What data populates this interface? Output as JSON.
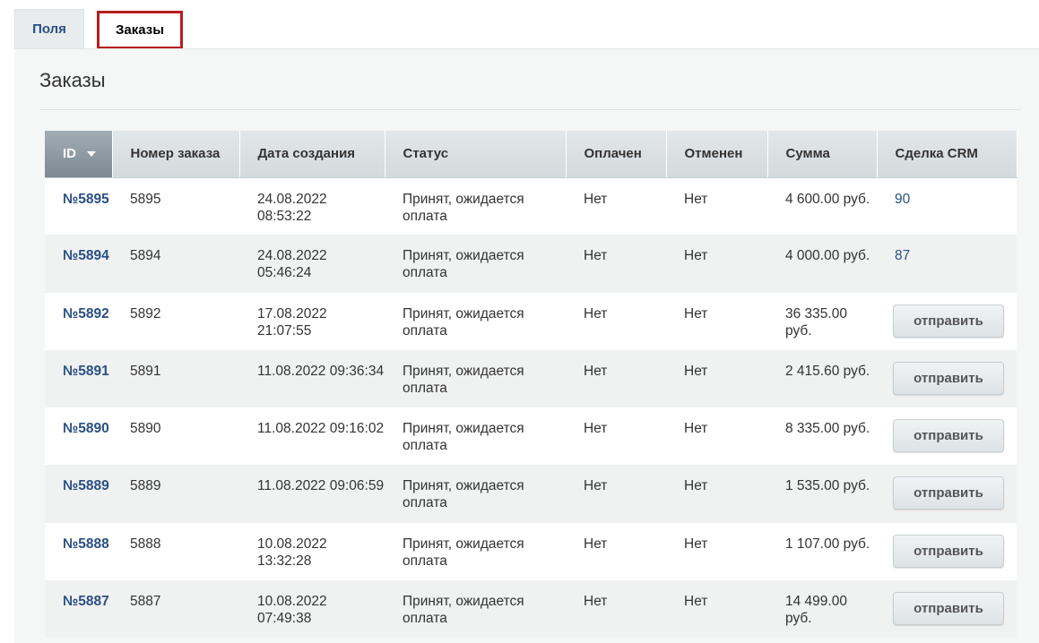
{
  "tabs": [
    {
      "label": "Поля"
    },
    {
      "label": "Заказы"
    }
  ],
  "section_title": "Заказы",
  "columns": [
    "ID",
    "Номер заказа",
    "Дата создания",
    "Статус",
    "Оплачен",
    "Отменен",
    "Сумма",
    "Сделка CRM"
  ],
  "rows": [
    {
      "id": "№5895",
      "number": "5895",
      "date": "24.08.2022 08:53:22",
      "status": "Принят, ожидается оплата",
      "paid": "Нет",
      "canceled": "Нет",
      "sum": "4 600.00 руб.",
      "deal": "90",
      "action": ""
    },
    {
      "id": "№5894",
      "number": "5894",
      "date": "24.08.2022 05:46:24",
      "status": "Принят, ожидается оплата",
      "paid": "Нет",
      "canceled": "Нет",
      "sum": "4 000.00 руб.",
      "deal": "87",
      "action": ""
    },
    {
      "id": "№5892",
      "number": "5892",
      "date": "17.08.2022 21:07:55",
      "status": "Принят, ожидается оплата",
      "paid": "Нет",
      "canceled": "Нет",
      "sum": "36 335.00 руб.",
      "deal": "",
      "action": "отправить"
    },
    {
      "id": "№5891",
      "number": "5891",
      "date": "11.08.2022 09:36:34",
      "status": "Принят, ожидается оплата",
      "paid": "Нет",
      "canceled": "Нет",
      "sum": "2 415.60 руб.",
      "deal": "",
      "action": "отправить"
    },
    {
      "id": "№5890",
      "number": "5890",
      "date": "11.08.2022 09:16:02",
      "status": "Принят, ожидается оплата",
      "paid": "Нет",
      "canceled": "Нет",
      "sum": "8 335.00 руб.",
      "deal": "",
      "action": "отправить"
    },
    {
      "id": "№5889",
      "number": "5889",
      "date": "11.08.2022 09:06:59",
      "status": "Принят, ожидается оплата",
      "paid": "Нет",
      "canceled": "Нет",
      "sum": "1 535.00 руб.",
      "deal": "",
      "action": "отправить"
    },
    {
      "id": "№5888",
      "number": "5888",
      "date": "10.08.2022 13:32:28",
      "status": "Принят, ожидается оплата",
      "paid": "Нет",
      "canceled": "Нет",
      "sum": "1 107.00 руб.",
      "deal": "",
      "action": "отправить"
    },
    {
      "id": "№5887",
      "number": "5887",
      "date": "10.08.2022 07:49:38",
      "status": "Принят, ожидается оплата",
      "paid": "Нет",
      "canceled": "Нет",
      "sum": "14 499.00 руб.",
      "deal": "",
      "action": "отправить"
    }
  ],
  "colors": {
    "accent": "#b41e1e",
    "link": "#2a5082"
  },
  "icons": {
    "sort": "chevron-down-icon"
  }
}
